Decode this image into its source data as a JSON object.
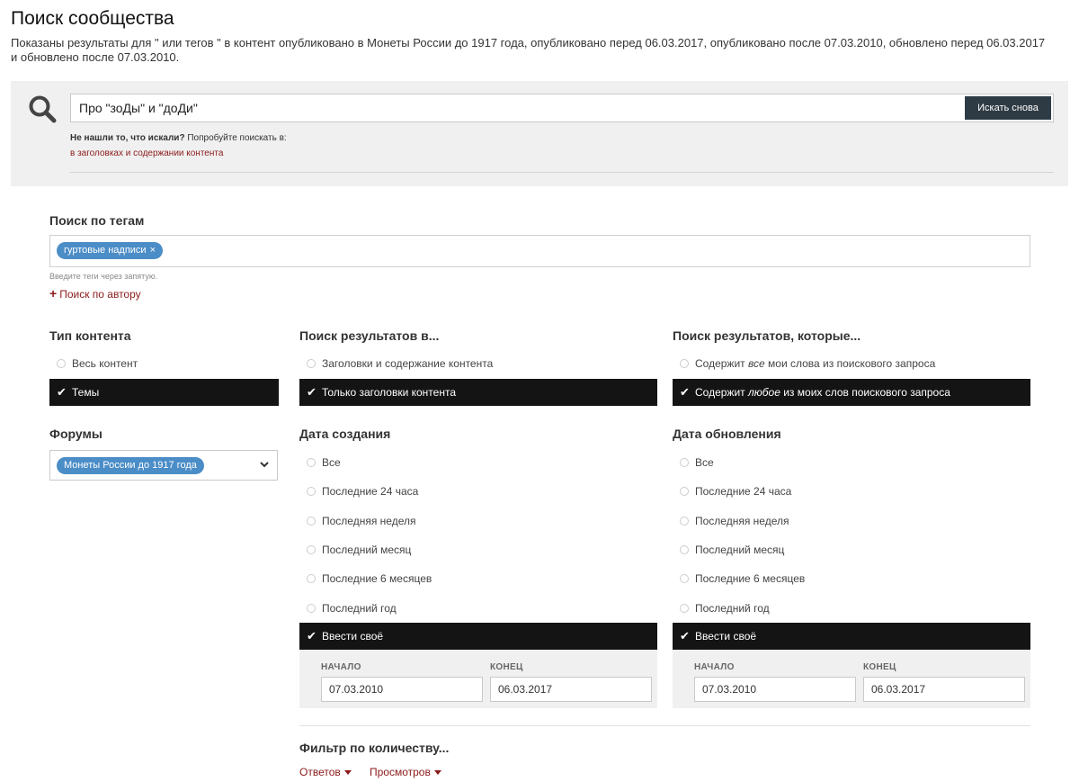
{
  "page": {
    "title": "Поиск сообщества",
    "description": "Показаны результаты для \" или тегов \" в контент опубликовано в Монеты России до 1917 года, опубликовано перед 06.03.2017, опубликовано после 07.03.2010, обновлено перед 06.03.2017 и обновлено после 07.03.2010."
  },
  "search": {
    "query": "Про \"зоДы\" и \"доДи\"",
    "button_label": "Искать снова",
    "not_found_bold": "Не нашли то, что искали?",
    "not_found_rest": " Попробуйте поискать в:",
    "alt_link": "в заголовках и содержании контента"
  },
  "tags": {
    "heading": "Поиск по тегам",
    "selected": "гуртовые надписи",
    "remove_symbol": "×",
    "hint": "Введите теги через запятую.",
    "author_plus": "+",
    "author_link": "Поиск по автору"
  },
  "content_type": {
    "heading": "Тип контента",
    "options": [
      "Весь контент",
      "Темы"
    ],
    "selected_index": 1
  },
  "forums": {
    "heading": "Форумы",
    "selected": "Монеты России до 1917 года"
  },
  "search_in": {
    "heading": "Поиск результатов в...",
    "options": [
      "Заголовки и содержание контента",
      "Только заголовки контента"
    ],
    "selected_index": 1
  },
  "results_which": {
    "heading": "Поиск результатов, которые...",
    "option_all_pre": "Содержит ",
    "option_all_em": "все",
    "option_all_post": " мои слова из поискового запроса",
    "option_any_pre": "Содержит ",
    "option_any_em": "любое",
    "option_any_post": " из моих слов поискового запроса",
    "selected_index": 1
  },
  "created": {
    "heading": "Дата создания",
    "options": [
      "Все",
      "Последние 24 часа",
      "Последняя неделя",
      "Последний месяц",
      "Последние 6 месяцев",
      "Последний год"
    ],
    "custom_label": "Ввести своё",
    "start_label": "НАЧАЛО",
    "end_label": "КОНЕЦ",
    "start_value": "07.03.2010",
    "end_value": "06.03.2017"
  },
  "updated": {
    "heading": "Дата обновления",
    "options": [
      "Все",
      "Последние 24 часа",
      "Последняя неделя",
      "Последний месяц",
      "Последние 6 месяцев",
      "Последний год"
    ],
    "custom_label": "Ввести своё",
    "start_label": "НАЧАЛО",
    "end_label": "КОНЕЦ",
    "start_value": "07.03.2010",
    "end_value": "06.03.2017"
  },
  "count_filter": {
    "heading": "Фильтр по количеству...",
    "replies": "Ответов",
    "views": "Просмотров"
  },
  "colors": {
    "link": "#8b1a1a",
    "selected_bg": "#141414",
    "pill_bg": "#4b8dc7",
    "button_bg": "#2f3b44",
    "panel_bg": "#f0f0f0"
  }
}
